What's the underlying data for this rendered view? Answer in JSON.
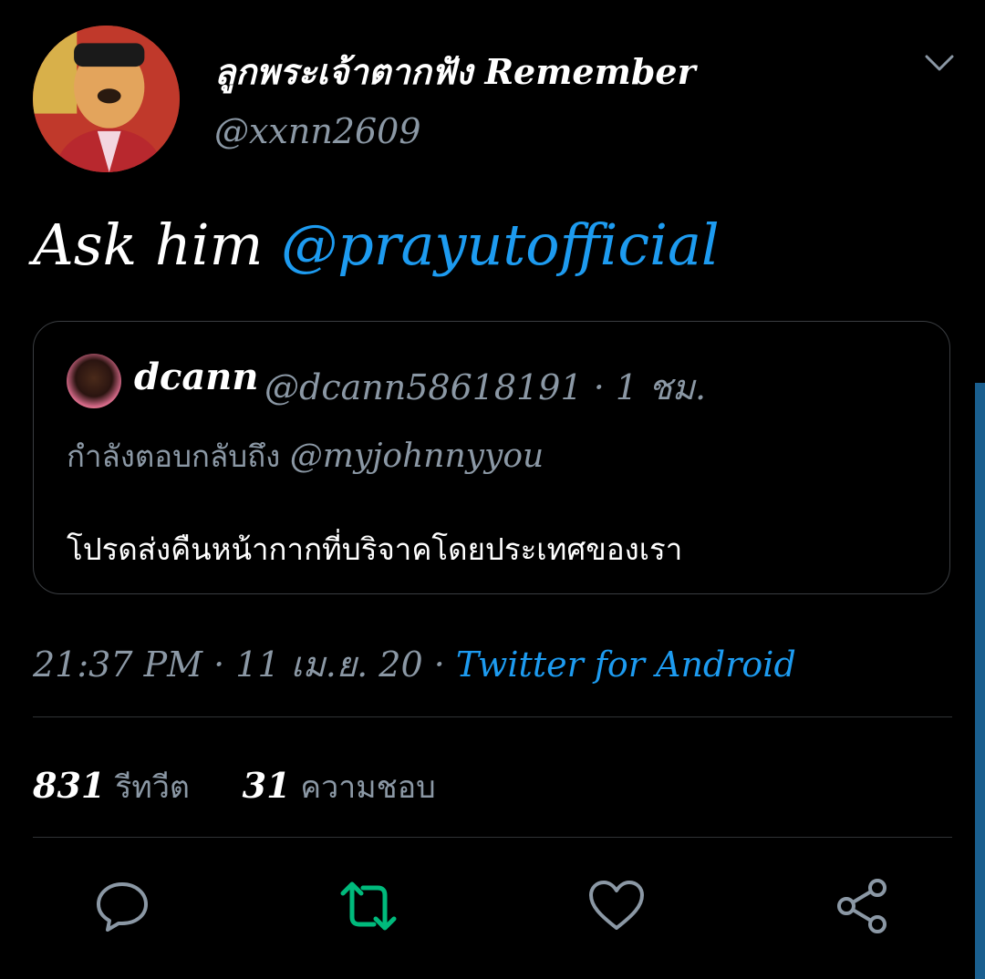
{
  "tweet": {
    "author": {
      "display_name": "ลูกพระเจ้าตากฟัง Remember",
      "handle": "@xxnn2609"
    },
    "text_prefix": "Ask him ",
    "mention": "@prayutofficial",
    "quoted": {
      "name": "dcann",
      "meta": "@dcann58618191 · 1 ชม.",
      "reply_prefix": "กำลังตอบกลับถึง ",
      "reply_mention": "@myjohnnyyou",
      "text": "โปรดส่งคืนหน้ากากที่บริจาคโดยประเทศของเรา"
    },
    "timestamp": "21:37 PM · 11 เม.ย. 20 · ",
    "source": "Twitter for Android",
    "stats": {
      "retweets_count": "831",
      "retweets_label": "รีทวีต",
      "likes_count": "31",
      "likes_label": "ความชอบ"
    }
  },
  "icons": {
    "menu": "chevron-down-icon",
    "reply": "reply-icon",
    "retweet": "retweet-icon",
    "like": "heart-icon",
    "share": "share-icon"
  },
  "colors": {
    "background": "#000000",
    "accent": "#1d9bf0",
    "retweet_active": "#00ba7c",
    "muted": "#8b98a5"
  }
}
